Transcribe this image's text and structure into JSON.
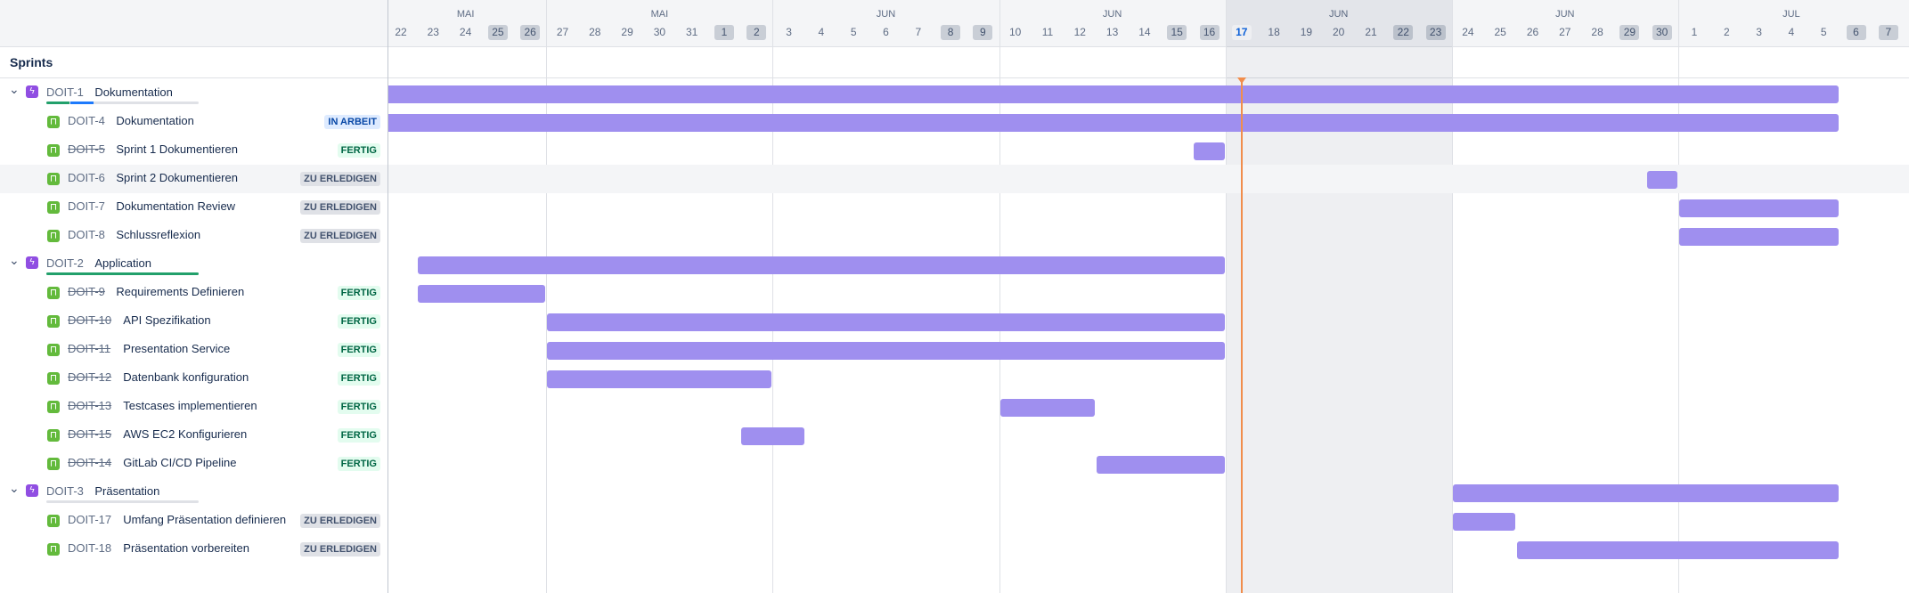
{
  "header": {
    "sprints_label": "Sprints",
    "weeks": [
      {
        "label": "MAI",
        "days": [
          {
            "d": "22"
          },
          {
            "d": "23"
          },
          {
            "d": "24"
          },
          {
            "d": "25",
            "weekend": true
          },
          {
            "d": "26",
            "weekend": true
          }
        ]
      },
      {
        "label": "MAI",
        "days": [
          {
            "d": "27"
          },
          {
            "d": "28"
          },
          {
            "d": "29"
          },
          {
            "d": "30"
          },
          {
            "d": "31"
          },
          {
            "d": "1",
            "weekend": true
          },
          {
            "d": "2",
            "weekend": true
          }
        ]
      },
      {
        "label": "JUN",
        "days": [
          {
            "d": "3"
          },
          {
            "d": "4"
          },
          {
            "d": "5"
          },
          {
            "d": "6"
          },
          {
            "d": "7"
          },
          {
            "d": "8",
            "weekend": true
          },
          {
            "d": "9",
            "weekend": true
          }
        ]
      },
      {
        "label": "JUN",
        "days": [
          {
            "d": "10"
          },
          {
            "d": "11"
          },
          {
            "d": "12"
          },
          {
            "d": "13"
          },
          {
            "d": "14"
          },
          {
            "d": "15",
            "weekend": true
          },
          {
            "d": "16",
            "weekend": true
          }
        ]
      },
      {
        "label": "JUN",
        "days": [
          {
            "d": "17",
            "today": true
          },
          {
            "d": "18"
          },
          {
            "d": "19"
          },
          {
            "d": "20"
          },
          {
            "d": "21"
          },
          {
            "d": "22",
            "weekend": true
          },
          {
            "d": "23",
            "weekend": true
          }
        ]
      },
      {
        "label": "JUN",
        "days": [
          {
            "d": "24"
          },
          {
            "d": "25"
          },
          {
            "d": "26"
          },
          {
            "d": "27"
          },
          {
            "d": "28"
          },
          {
            "d": "29",
            "weekend": true
          },
          {
            "d": "30",
            "weekend": true
          }
        ]
      },
      {
        "label": "JUL",
        "days": [
          {
            "d": "1"
          },
          {
            "d": "2"
          },
          {
            "d": "3"
          },
          {
            "d": "4"
          },
          {
            "d": "5"
          },
          {
            "d": "6",
            "weekend": true
          },
          {
            "d": "7",
            "weekend": true
          }
        ]
      }
    ]
  },
  "today_label": "17",
  "rows": [
    {
      "type": "epic",
      "key": "DOIT-1",
      "title": "Dokumentation",
      "progress": [
        {
          "color": "#22a06b",
          "frac": 0.15
        },
        {
          "color": "#1d7afc",
          "frac": 0.15
        }
      ],
      "bar": {
        "start": 0,
        "end": 45
      }
    },
    {
      "type": "story",
      "key": "DOIT-4",
      "title": "Dokumentation",
      "done": false,
      "status": "IN ARBEIT",
      "status_type": "progress",
      "bar": {
        "start": 0,
        "end": 45
      }
    },
    {
      "type": "story",
      "key": "DOIT-5",
      "title": "Sprint 1 Dokumentieren",
      "done": true,
      "status": "FERTIG",
      "status_type": "done",
      "bar": {
        "start": 25,
        "end": 26
      }
    },
    {
      "type": "story",
      "key": "DOIT-6",
      "title": "Sprint 2 Dokumentieren",
      "done": false,
      "status": "ZU ERLEDIGEN",
      "status_type": "todo",
      "highlight": true,
      "bar": {
        "start": 39,
        "end": 40
      }
    },
    {
      "type": "story",
      "key": "DOIT-7",
      "title": "Dokumentation Review",
      "done": false,
      "status": "ZU ERLEDIGEN",
      "status_type": "todo",
      "bar": {
        "start": 40,
        "end": 45
      }
    },
    {
      "type": "story",
      "key": "DOIT-8",
      "title": "Schlussreflexion",
      "done": false,
      "status": "ZU ERLEDIGEN",
      "status_type": "todo",
      "bar": {
        "start": 40,
        "end": 45
      }
    },
    {
      "type": "epic",
      "key": "DOIT-2",
      "title": "Application",
      "progress": [
        {
          "color": "#22a06b",
          "frac": 1.0
        }
      ],
      "bar": {
        "start": 1,
        "end": 26
      }
    },
    {
      "type": "story",
      "key": "DOIT-9",
      "title": "Requirements Definieren",
      "done": true,
      "status": "FERTIG",
      "status_type": "done",
      "bar": {
        "start": 1,
        "end": 5
      }
    },
    {
      "type": "story",
      "key": "DOIT-10",
      "title": "API Spezifikation",
      "done": true,
      "status": "FERTIG",
      "status_type": "done",
      "bar": {
        "start": 5,
        "end": 26
      }
    },
    {
      "type": "story",
      "key": "DOIT-11",
      "title": "Presentation Service",
      "done": true,
      "status": "FERTIG",
      "status_type": "done",
      "bar": {
        "start": 5,
        "end": 26
      }
    },
    {
      "type": "story",
      "key": "DOIT-12",
      "title": "Datenbank konfiguration",
      "done": true,
      "status": "FERTIG",
      "status_type": "done",
      "bar": {
        "start": 5,
        "end": 12
      }
    },
    {
      "type": "story",
      "key": "DOIT-13",
      "title": "Testcases implementieren",
      "done": true,
      "status": "FERTIG",
      "status_type": "done",
      "bar": {
        "start": 19,
        "end": 22
      }
    },
    {
      "type": "story",
      "key": "DOIT-15",
      "title": "AWS EC2 Konfigurieren",
      "done": true,
      "status": "FERTIG",
      "status_type": "done",
      "bar": {
        "start": 11,
        "end": 13
      }
    },
    {
      "type": "story",
      "key": "DOIT-14",
      "title": "GitLab CI/CD Pipeline",
      "done": true,
      "status": "FERTIG",
      "status_type": "done",
      "bar": {
        "start": 22,
        "end": 26
      }
    },
    {
      "type": "epic",
      "key": "DOIT-3",
      "title": "Präsentation",
      "progress": [],
      "bar": {
        "start": 33,
        "end": 45
      }
    },
    {
      "type": "story",
      "key": "DOIT-17",
      "title": "Umfang Präsentation definieren",
      "done": false,
      "status": "ZU ERLEDIGEN",
      "status_type": "todo",
      "bar": {
        "start": 33,
        "end": 35
      }
    },
    {
      "type": "story",
      "key": "DOIT-18",
      "title": "Präsentation vorbereiten",
      "done": false,
      "status": "ZU ERLEDIGEN",
      "status_type": "todo",
      "bar": {
        "start": 35,
        "end": 45
      }
    }
  ],
  "colors": {
    "bar": "#9f8fef",
    "today_line": "#f18d4c",
    "epic_icon": "#904ee2",
    "story_icon": "#63ba3c"
  }
}
